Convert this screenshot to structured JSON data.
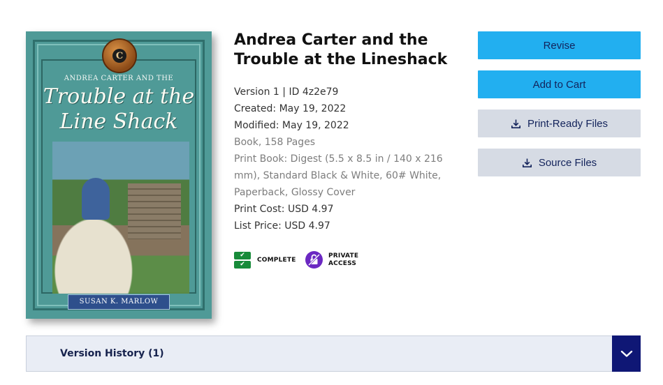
{
  "book": {
    "cover": {
      "series_mark": "C",
      "series_line": "ANDREA CARTER AND THE",
      "title_line1": "Trouble at the",
      "title_line2": "Line Shack",
      "author": "SUSAN K. MARLOW"
    },
    "title": "Andrea Carter and the Trouble at the Lineshack",
    "details": {
      "version_id": "Version 1 | ID 4z2e79",
      "created": "Created: May 19, 2022",
      "modified": "Modified: May 19, 2022",
      "format": "Book, 158 Pages",
      "print_spec": "Print Book: Digest (5.5 x 8.5 in / 140 x 216 mm), Standard Black & White, 60# White, Paperback, Glossy Cover",
      "print_cost": "Print Cost: USD 4.97",
      "list_price": "List Price: USD 4.97"
    },
    "badges": {
      "complete": "COMPLETE",
      "private_line1": "PRIVATE",
      "private_line2": "ACCESS"
    }
  },
  "actions": {
    "revise": "Revise",
    "add_to_cart": "Add to Cart",
    "print_ready": "Print-Ready Files",
    "source_files": "Source Files"
  },
  "history": {
    "label": "Version History (1)",
    "toggle_icon": "chevron-down-icon"
  },
  "colors": {
    "primary_button": "#22aff0",
    "secondary_button": "#d6dbe4",
    "button_text": "#13235b",
    "complete_green": "#188b3a",
    "private_purple": "#6b28c2",
    "history_toggle": "#0f1775"
  }
}
